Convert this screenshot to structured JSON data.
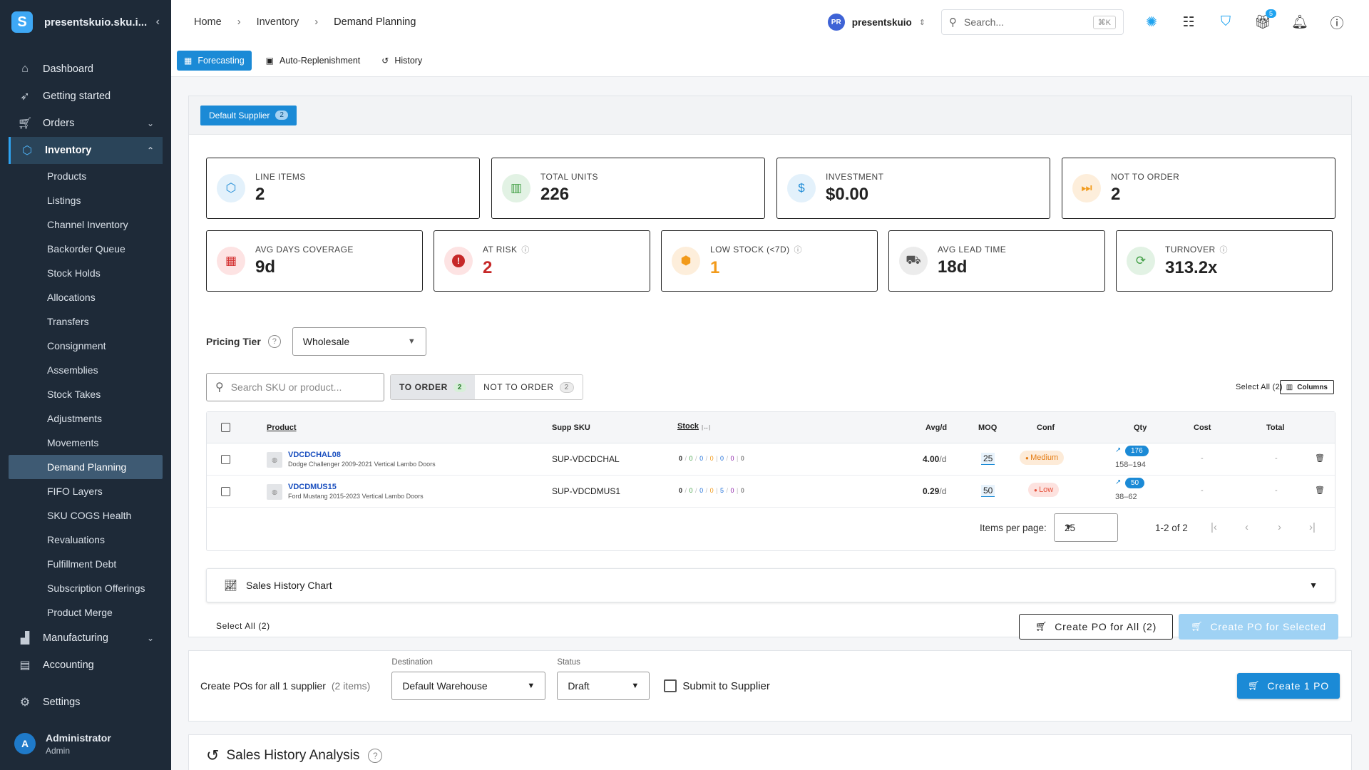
{
  "app": {
    "workspace": "presentskuio.sku.i...",
    "logo_letter": "S"
  },
  "sidebar": {
    "items": [
      {
        "label": "Dashboard",
        "icon": "home-icon"
      },
      {
        "label": "Getting started",
        "icon": "rocket-icon"
      },
      {
        "label": "Orders",
        "icon": "cart-icon"
      },
      {
        "label": "Inventory",
        "icon": "cube-icon"
      },
      {
        "label": "Manufacturing",
        "icon": "factory-icon"
      },
      {
        "label": "Accounting",
        "icon": "book-icon"
      },
      {
        "label": "Settings",
        "icon": "gear-icon"
      }
    ],
    "inventory_sub": [
      "Products",
      "Listings",
      "Channel Inventory",
      "Backorder Queue",
      "Stock Holds",
      "Allocations",
      "Transfers",
      "Consignment",
      "Assemblies",
      "Stock Takes",
      "Adjustments",
      "Movements",
      "Demand Planning",
      "FIFO Layers",
      "SKU COGS Health",
      "Revaluations",
      "Fulfillment Debt",
      "Subscription Offerings",
      "Product Merge"
    ],
    "user": {
      "initial": "A",
      "name": "Administrator",
      "role": "Admin"
    }
  },
  "header": {
    "breadcrumb": [
      "Home",
      "Inventory",
      "Demand Planning"
    ],
    "account_initials": "PR",
    "account_name": "presentskuio",
    "search_placeholder": "Search...",
    "search_shortcut": "⌘K",
    "gift_count": "5"
  },
  "tabs": [
    {
      "label": "Forecasting",
      "active": true
    },
    {
      "label": "Auto-Replenishment",
      "active": false
    },
    {
      "label": "History",
      "active": false
    }
  ],
  "supplier": {
    "label": "Default Supplier",
    "count": "2"
  },
  "stats_row1": [
    {
      "label": "LINE ITEMS",
      "value": "2",
      "icon": "cube-icon",
      "bg": "#e3f1fb",
      "fg": "#1b8ad6",
      "valcolor": "#222"
    },
    {
      "label": "TOTAL UNITS",
      "value": "226",
      "icon": "units-icon",
      "bg": "#e2f2e4",
      "fg": "#43a047",
      "valcolor": "#222"
    },
    {
      "label": "INVESTMENT",
      "value": "$0.00",
      "icon": "dollar-icon",
      "bg": "#e3f1fb",
      "fg": "#1b8ad6",
      "valcolor": "#222"
    },
    {
      "label": "NOT TO ORDER",
      "value": "2",
      "icon": "skip-icon",
      "bg": "#fdeedb",
      "fg": "#f29a1a",
      "valcolor": "#222"
    }
  ],
  "stats_row2": [
    {
      "label": "AVG DAYS COVERAGE",
      "value": "9d",
      "icon": "calendar-icon",
      "bg": "#fde3e3",
      "fg": "#d32f2f",
      "valcolor": "#222",
      "help": false
    },
    {
      "label": "AT RISK",
      "value": "2",
      "icon": "alert-icon",
      "bg": "#fde3e3",
      "fg": "#c62828",
      "valcolor": "#c62828",
      "help": true
    },
    {
      "label": "LOW STOCK (<7D)",
      "value": "1",
      "icon": "box-warning-icon",
      "bg": "#fdeedb",
      "fg": "#f29a1a",
      "valcolor": "#f29a1a",
      "help": true
    },
    {
      "label": "AVG LEAD TIME",
      "value": "18d",
      "icon": "truck-icon",
      "bg": "#ececec",
      "fg": "#555",
      "valcolor": "#222",
      "help": false
    },
    {
      "label": "TURNOVER",
      "value": "313.2x",
      "icon": "refresh-icon",
      "bg": "#e2f2e4",
      "fg": "#43a047",
      "valcolor": "#222",
      "help": true
    }
  ],
  "pricing": {
    "label": "Pricing Tier",
    "value": "Wholesale"
  },
  "filters": {
    "search_placeholder": "Search SKU or product...",
    "to_order_label": "TO ORDER",
    "to_order_count": "2",
    "not_to_order_label": "NOT TO ORDER",
    "not_to_order_count": "2",
    "select_all": "Select All (2)",
    "columns": "Columns"
  },
  "table": {
    "headers": {
      "product": "Product",
      "supp_sku": "Supp SKU",
      "stock": "Stock",
      "stock_hint": "|↔|",
      "avg": "Avg/d",
      "moq": "MOQ",
      "conf": "Conf",
      "qty": "Qty",
      "cost": "Cost",
      "total": "Total"
    },
    "rows": [
      {
        "sku": "VDCDCHAL08",
        "desc": "Dodge Challenger 2009-2021 Vertical Lambo Doors",
        "supp_sku": "SUP-VDCDCHAL",
        "stock": [
          "0",
          "0",
          "0",
          "0",
          "0",
          "0",
          "0"
        ],
        "avg_value": "4.00",
        "avg_unit": "/d",
        "moq": "25",
        "conf": "Medium",
        "qty": "176",
        "range": "158–194",
        "cost": "-",
        "total": "-"
      },
      {
        "sku": "VDCDMUS15",
        "desc": "Ford Mustang 2015-2023 Vertical Lambo Doors",
        "supp_sku": "SUP-VDCDMUS1",
        "stock": [
          "0",
          "0",
          "0",
          "0",
          "5",
          "0",
          "0"
        ],
        "avg_value": "0.29",
        "avg_unit": "/d",
        "moq": "50",
        "conf": "Low",
        "qty": "50",
        "range": "38–62",
        "cost": "-",
        "total": "-"
      }
    ],
    "pagination": {
      "label": "Items per page:",
      "per_page": "25",
      "range": "1-2 of 2"
    }
  },
  "chart_panel": {
    "title": "Sales History Chart"
  },
  "actions": {
    "select_all": "Select All (2)",
    "create_all": "Create PO for All (2)",
    "create_selected": "Create PO for Selected"
  },
  "po": {
    "label": "Create POs for all 1 supplier",
    "items": "(2 items)",
    "destination_label": "Destination",
    "destination": "Default Warehouse",
    "status_label": "Status",
    "status": "Draft",
    "submit_label": "Submit to Supplier",
    "create_button": "Create 1 PO"
  },
  "analysis": {
    "title": "Sales History Analysis"
  }
}
